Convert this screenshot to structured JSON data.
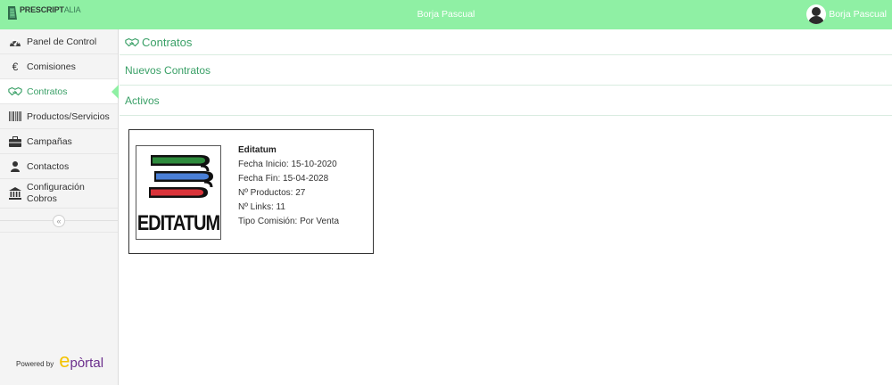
{
  "header": {
    "brand_name_part1": "PRESCRIPT",
    "brand_name_part2": "ALIA",
    "user_center": "Borja Pascual",
    "user_right": "Borja Pascual"
  },
  "sidebar": {
    "items": [
      {
        "label": "Panel de Control",
        "icon": "dashboard-icon"
      },
      {
        "label": "Comisiones",
        "icon": "euro-icon"
      },
      {
        "label": "Contratos",
        "icon": "handshake-icon",
        "active": true
      },
      {
        "label": "Productos/Servicios",
        "icon": "barcode-icon"
      },
      {
        "label": "Campañas",
        "icon": "briefcase-icon"
      },
      {
        "label": "Contactos",
        "icon": "user-icon"
      },
      {
        "label_line1": "Configuración",
        "label_line2": "Cobros",
        "icon": "bank-icon"
      }
    ],
    "collapse_symbol": "«",
    "powered_by": "Powered by",
    "eportal_e": "e",
    "eportal_rest": "pòrtal"
  },
  "main": {
    "title": "Contratos",
    "sections": [
      "Nuevos Contratos",
      "Activos"
    ],
    "contract": {
      "logo_text": "EDITATUM",
      "name": "Editatum",
      "start": "Fecha Inicio: 15-10-2020",
      "end": "Fecha Fin: 15-04-2028",
      "products": "Nº Productos: 27",
      "links": "Nº Links: 11",
      "commission": "Tipo Comisión: Por Venta"
    }
  },
  "colors": {
    "topbar": "#8ff0a4",
    "accent": "#3aa067",
    "book_green": "#2e8b3d",
    "book_blue": "#4a7fd6",
    "book_red": "#d9333a"
  }
}
